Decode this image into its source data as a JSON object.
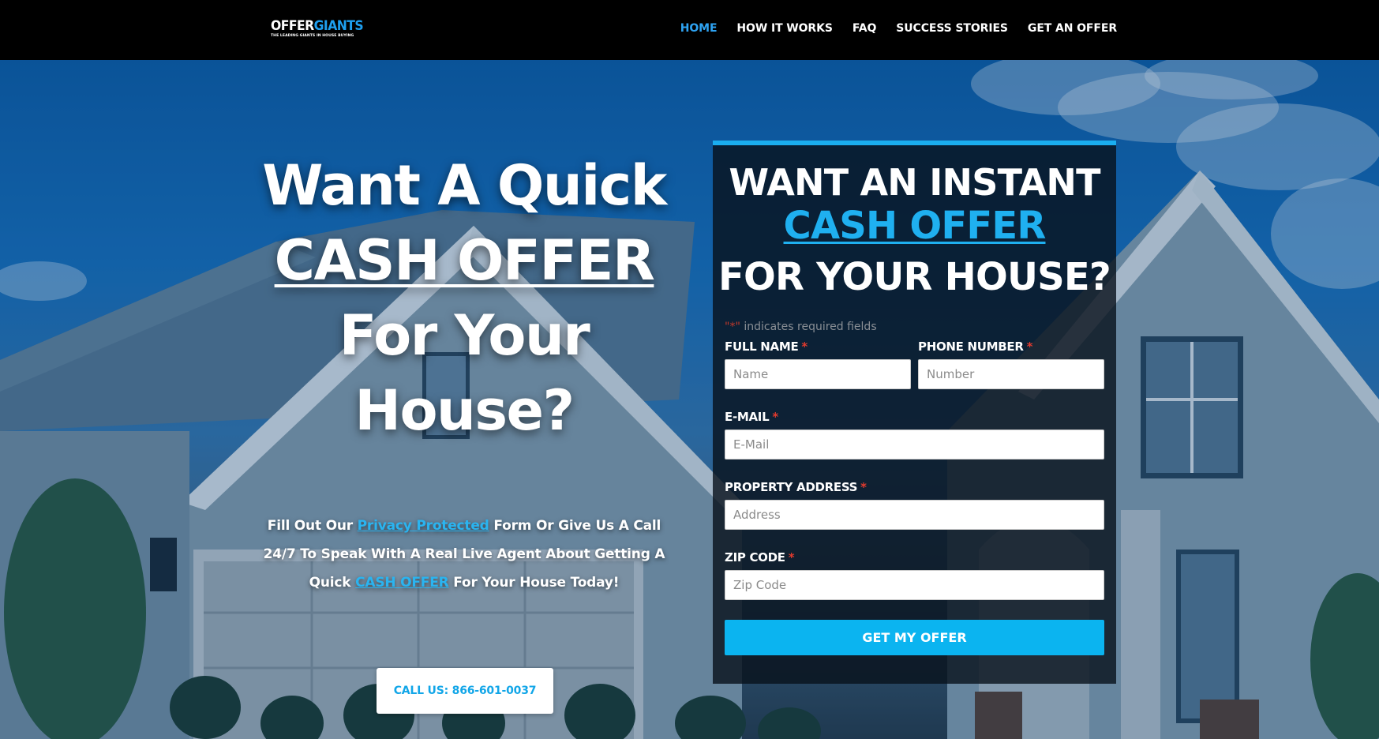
{
  "brand": {
    "logo_main": "OFFER",
    "logo_accent": "GIANTS",
    "logo_tagline": "THE LEADING GIANTS IN HOUSE BUYING"
  },
  "nav": {
    "items": [
      {
        "label": "HOME",
        "active": true
      },
      {
        "label": "HOW IT WORKS",
        "active": false
      },
      {
        "label": "FAQ",
        "active": false
      },
      {
        "label": "SUCCESS STORIES",
        "active": false
      },
      {
        "label": "GET AN OFFER",
        "active": false
      }
    ]
  },
  "hero": {
    "headline_1": "Want A Quick",
    "headline_2": "CASH OFFER",
    "headline_3": "For Your",
    "headline_4": "House?",
    "sub_1": "Fill Out Our ",
    "sub_link_1": "Privacy Protected",
    "sub_2": " Form Or Give Us A Call 24/7 To Speak With A Real Live Agent About Getting A Quick ",
    "sub_link_2": "CASH OFFER",
    "sub_3": " For Your House Today!",
    "call_button": "CALL US: 866-601-0037"
  },
  "form": {
    "heading_1": "WANT AN INSTANT",
    "heading_2": "CASH OFFER",
    "heading_3": "FOR YOUR HOUSE?",
    "required_note_star": "\"*\"",
    "required_note_text": " indicates required fields",
    "required_marker": "*",
    "fields": {
      "full_name": {
        "label": "FULL NAME",
        "placeholder": "Name"
      },
      "phone": {
        "label": "PHONE NUMBER",
        "placeholder": "Number"
      },
      "email": {
        "label": "E-MAIL",
        "placeholder": "E-Mail"
      },
      "address": {
        "label": "PROPERTY ADDRESS",
        "placeholder": "Address"
      },
      "zip": {
        "label": "ZIP CODE",
        "placeholder": "Zip Code"
      }
    },
    "submit": "GET MY OFFER"
  },
  "colors": {
    "accent": "#1aaef0",
    "nav_active": "#2ea3f2",
    "required": "#e23b2e"
  }
}
